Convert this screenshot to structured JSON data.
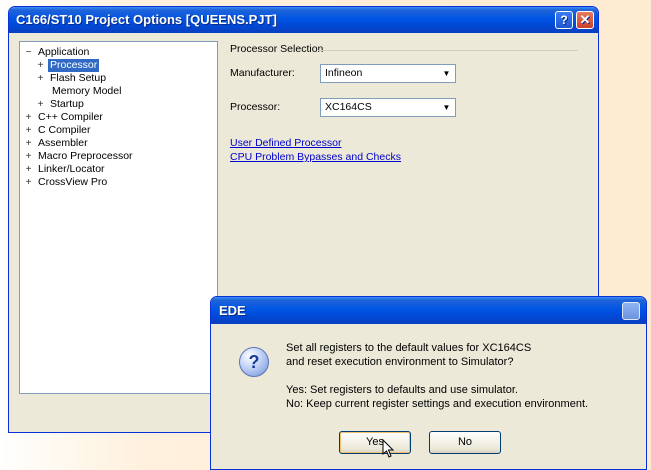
{
  "main_window": {
    "title": "C166/ST10 Project Options [QUEENS.PJT]",
    "help_button": "?",
    "close_button": "✕"
  },
  "tree": [
    {
      "expander": "−",
      "label": "Application",
      "selected": false
    },
    {
      "expander": "+",
      "label": "Processor",
      "selected": true
    },
    {
      "expander": "+",
      "label": "Flash Setup",
      "selected": false
    },
    {
      "expander": "",
      "label": "Memory Model",
      "selected": false
    },
    {
      "expander": "+",
      "label": "Startup",
      "selected": false
    },
    {
      "expander": "+",
      "label": "C++ Compiler",
      "selected": false
    },
    {
      "expander": "+",
      "label": "C Compiler",
      "selected": false
    },
    {
      "expander": "+",
      "label": "Assembler",
      "selected": false
    },
    {
      "expander": "+",
      "label": "Macro Preprocessor",
      "selected": false
    },
    {
      "expander": "+",
      "label": "Linker/Locator",
      "selected": false
    },
    {
      "expander": "+",
      "label": "CrossView Pro",
      "selected": false
    }
  ],
  "panel": {
    "group_title": "Processor Selection",
    "manufacturer_label": "Manufacturer:",
    "manufacturer_value": "Infineon",
    "processor_label": "Processor:",
    "processor_value": "XC164CS",
    "link_user_defined": "User Defined Processor",
    "link_bypasses": "CPU Problem Bypasses and Checks"
  },
  "dialog": {
    "title": "EDE",
    "question_icon": "?",
    "line1": "Set all registers to the default values for XC164CS",
    "line2": "and reset execution environment to Simulator?",
    "line3": "Yes:   Set registers to defaults and use simulator.",
    "line4": "No:     Keep current register settings and execution environment.",
    "yes_label": "Yes",
    "no_label": "No"
  }
}
